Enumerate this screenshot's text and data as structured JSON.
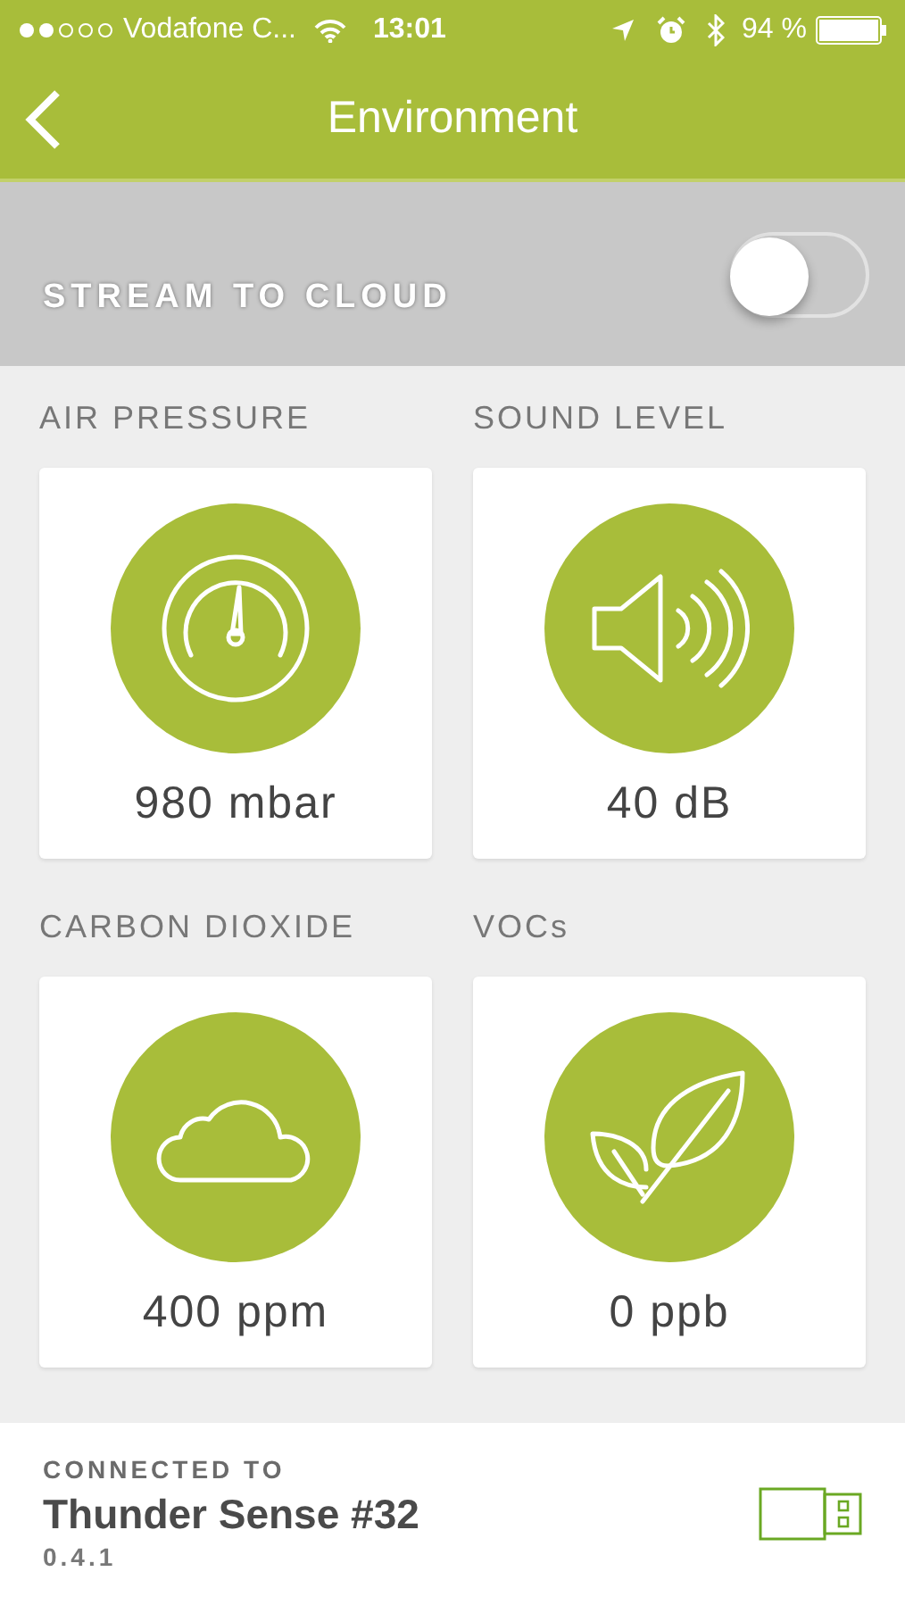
{
  "status_bar": {
    "carrier": "Vodafone C...",
    "time": "13:01",
    "battery": "94 %"
  },
  "nav": {
    "title": "Environment"
  },
  "stream": {
    "label": "STREAM TO CLOUD",
    "on": false
  },
  "sensors": [
    {
      "label": "AIR PRESSURE",
      "kind": "gauge",
      "value": "980 mbar"
    },
    {
      "label": "SOUND LEVEL",
      "kind": "speaker",
      "value": "40 dB"
    },
    {
      "label": "CARBON DIOXIDE",
      "kind": "cloud",
      "value": "400 ppm"
    },
    {
      "label": "VOCs",
      "kind": "leaf",
      "value": "0 ppb"
    }
  ],
  "footer": {
    "caption": "CONNECTED TO",
    "device": "Thunder Sense #32",
    "version": "0.4.1"
  }
}
